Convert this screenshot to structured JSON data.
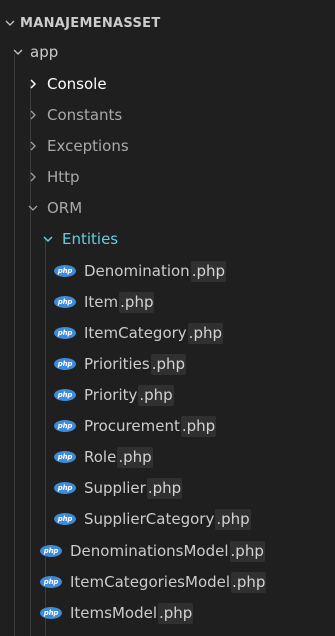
{
  "explorer": {
    "root": {
      "label": "MANAJEMENASSET",
      "expanded": true
    },
    "app_folder": {
      "label": "app",
      "expanded": true
    },
    "folders": [
      {
        "label": "Console",
        "expanded": false
      },
      {
        "label": "Constants",
        "expanded": false
      },
      {
        "label": "Exceptions",
        "expanded": false
      },
      {
        "label": "Http",
        "expanded": false
      },
      {
        "label": "ORM",
        "expanded": true
      }
    ],
    "entities_folder": {
      "label": "Entities",
      "expanded": true
    },
    "entity_files": [
      {
        "name": "Denomination",
        "ext": ".php"
      },
      {
        "name": "Item",
        "ext": ".php"
      },
      {
        "name": "ItemCategory",
        "ext": ".php"
      },
      {
        "name": "Priorities",
        "ext": ".php"
      },
      {
        "name": "Priority",
        "ext": ".php"
      },
      {
        "name": "Procurement",
        "ext": ".php"
      },
      {
        "name": "Role",
        "ext": ".php"
      },
      {
        "name": "Supplier",
        "ext": ".php"
      },
      {
        "name": "SupplierCategory",
        "ext": ".php"
      }
    ],
    "orm_files": [
      {
        "name": "DenominationsModel",
        "ext": ".php"
      },
      {
        "name": "ItemCategoriesModel",
        "ext": ".php"
      },
      {
        "name": "ItemsModel",
        "ext": ".php"
      }
    ],
    "file_icon_text": "php",
    "colors": {
      "background": "#1f1f1f",
      "php_icon": "#3d8bd9",
      "entities_accent": "#5fd0e0",
      "ext_highlight": "#303030"
    }
  }
}
